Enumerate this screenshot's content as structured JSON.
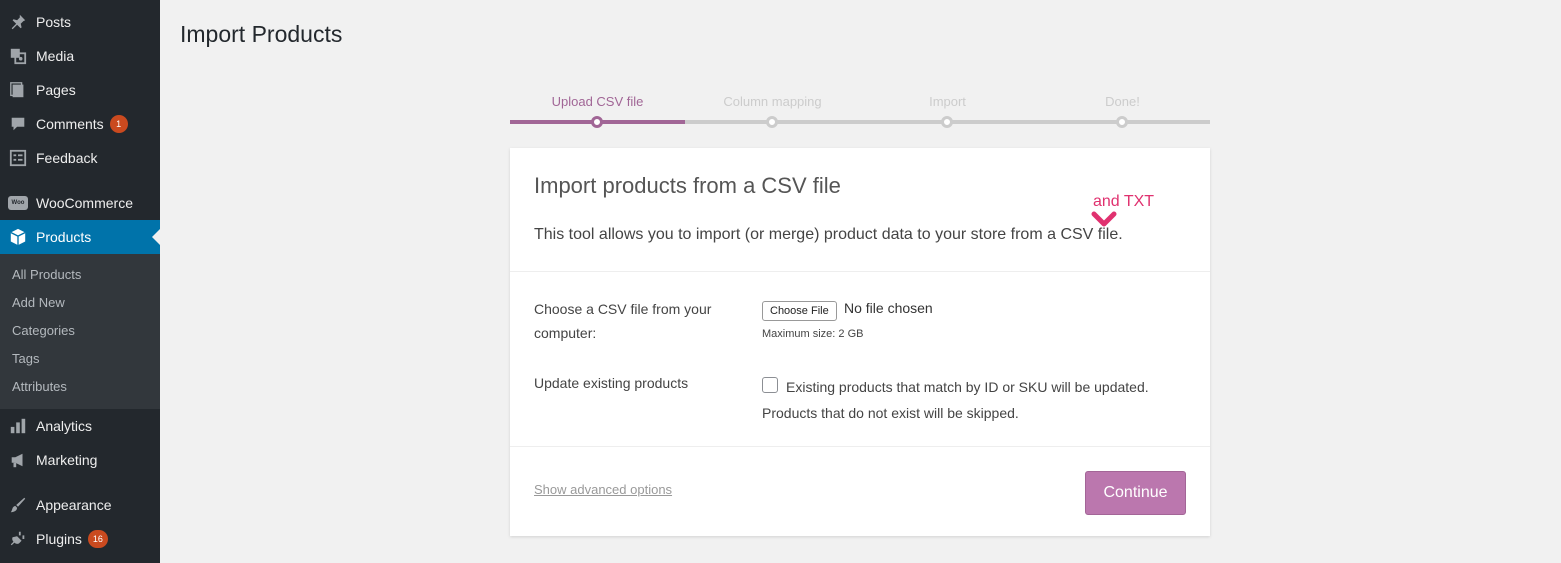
{
  "sidebar": {
    "items": [
      {
        "label": "Posts",
        "icon": "pin-icon"
      },
      {
        "label": "Media",
        "icon": "media-icon"
      },
      {
        "label": "Pages",
        "icon": "pages-icon"
      },
      {
        "label": "Comments",
        "icon": "comment-icon",
        "badge": "1"
      },
      {
        "label": "Feedback",
        "icon": "feedback-icon"
      },
      {
        "label": "WooCommerce",
        "icon": "woo-icon"
      },
      {
        "label": "Products",
        "icon": "box-icon"
      },
      {
        "label": "Analytics",
        "icon": "bar-chart-icon"
      },
      {
        "label": "Marketing",
        "icon": "megaphone-icon"
      },
      {
        "label": "Appearance",
        "icon": "brush-icon"
      },
      {
        "label": "Plugins",
        "icon": "plug-icon",
        "badge": "16"
      }
    ],
    "submenu": [
      "All Products",
      "Add New",
      "Categories",
      "Tags",
      "Attributes"
    ],
    "woo_icon_text": "Woo"
  },
  "page": {
    "title": "Import Products"
  },
  "steps": [
    {
      "label": "Upload CSV file",
      "active": true
    },
    {
      "label": "Column mapping",
      "active": false
    },
    {
      "label": "Import",
      "active": false
    },
    {
      "label": "Done!",
      "active": false
    }
  ],
  "card": {
    "title": "Import products from a CSV file",
    "description": "This tool allows you to import (or merge) product data to your store from a CSV file.",
    "annotation": "and TXT",
    "file_label": "Choose a CSV file from your computer:",
    "file_button": "Choose File",
    "file_status": "No file chosen",
    "max_size": "Maximum size: 2 GB",
    "update_label": "Update existing products",
    "update_text": "Existing products that match by ID or SKU will be updated. Products that do not exist will be skipped.",
    "advanced_link": "Show advanced options",
    "continue_button": "Continue"
  },
  "colors": {
    "sidebar_bg": "#23282d",
    "active_blue": "#0073aa",
    "woo_purple": "#bb77ae",
    "step_active": "#a16696",
    "annotation": "#e0316f",
    "badge": "#ca4a1f"
  }
}
